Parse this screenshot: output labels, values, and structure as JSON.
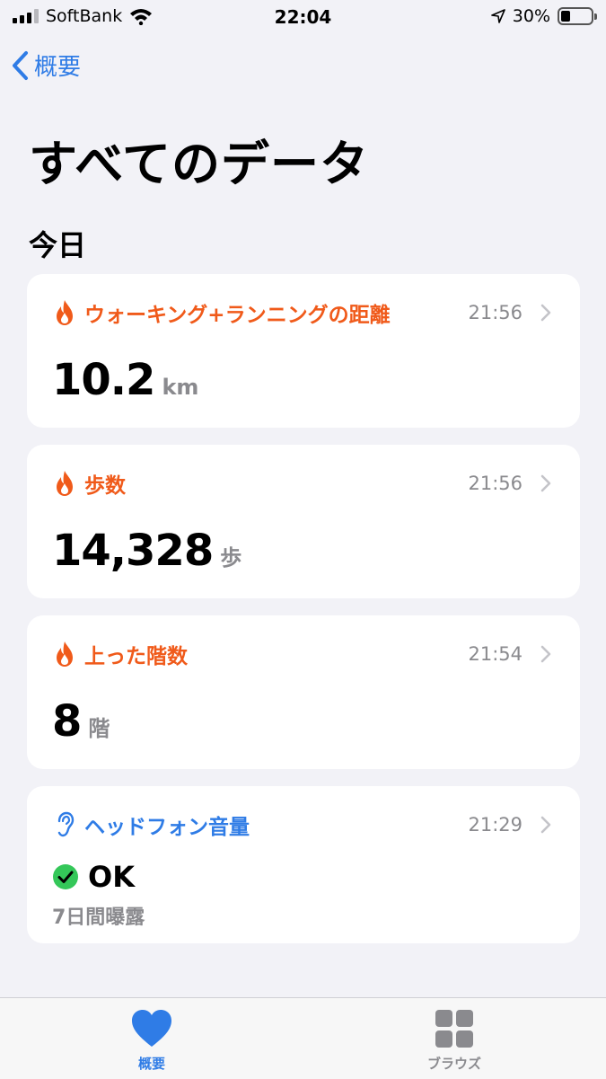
{
  "status_bar": {
    "carrier": "SoftBank",
    "time": "22:04",
    "battery": "30%",
    "battery_level": 0.3
  },
  "nav": {
    "back_label": "概要"
  },
  "page_title": "すべてのデータ",
  "section_title": "今日",
  "cards": [
    {
      "label": "ウォーキング+ランニングの距離",
      "time": "21:56",
      "value": "10.2",
      "unit": "km",
      "icon": "flame-icon"
    },
    {
      "label": "歩数",
      "time": "21:56",
      "value": "14,328",
      "unit": "歩",
      "icon": "flame-icon"
    },
    {
      "label": "上った階数",
      "time": "21:54",
      "value": "8",
      "unit": "階",
      "icon": "flame-icon"
    },
    {
      "label": "ヘッドフォン音量",
      "time": "21:29",
      "status": "OK",
      "sub": "7日間曝露",
      "icon": "ear-icon"
    }
  ],
  "colors": {
    "activity": "#f05a1a",
    "hearing": "#2f7ce6",
    "ok": "#34c759"
  },
  "tabs": [
    {
      "label": "概要",
      "icon": "heart-icon",
      "active": true
    },
    {
      "label": "ブラウズ",
      "icon": "grid-icon",
      "active": false
    }
  ]
}
